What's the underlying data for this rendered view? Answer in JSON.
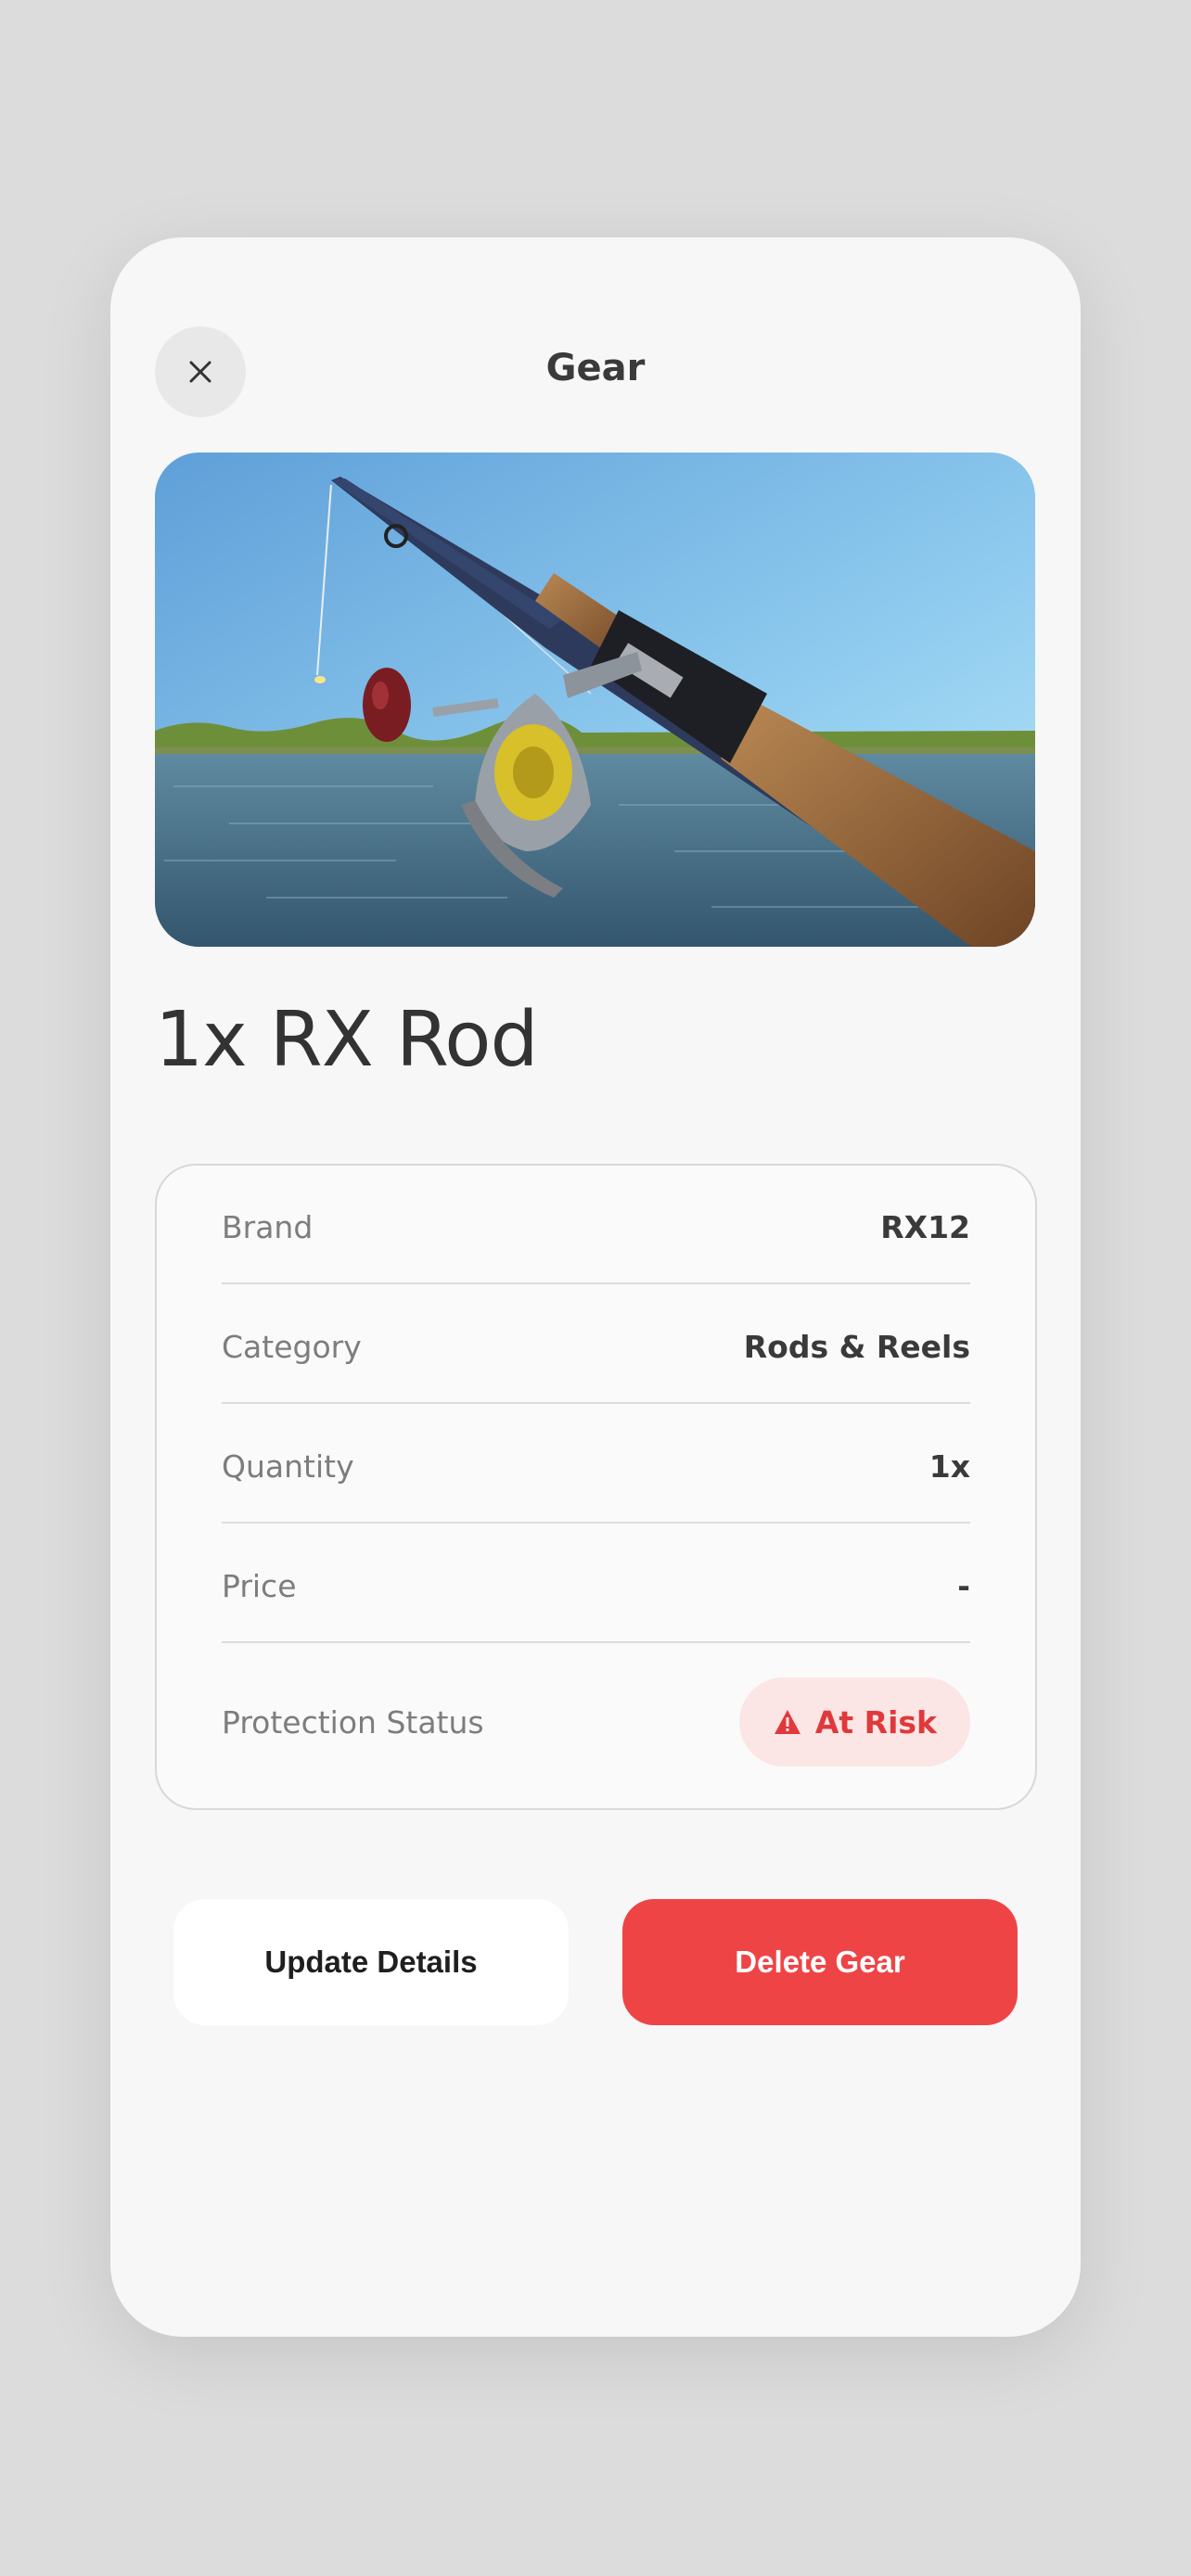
{
  "header": {
    "title": "Gear",
    "close_icon": "close-icon"
  },
  "item": {
    "title": "1x RX Rod",
    "image_alt": "Fishing rod and reel over a lake"
  },
  "details": [
    {
      "label": "Brand",
      "value": "RX12"
    },
    {
      "label": "Category",
      "value": "Rods & Reels"
    },
    {
      "label": "Quantity",
      "value": "1x"
    },
    {
      "label": "Price",
      "value": "-"
    }
  ],
  "protection": {
    "label": "Protection Status",
    "status": "At Risk",
    "icon": "warning-icon",
    "color": "#e0393c",
    "background": "#fbe5e5"
  },
  "actions": {
    "update_label": "Update Details",
    "delete_label": "Delete Gear",
    "delete_color": "#ef4446"
  }
}
